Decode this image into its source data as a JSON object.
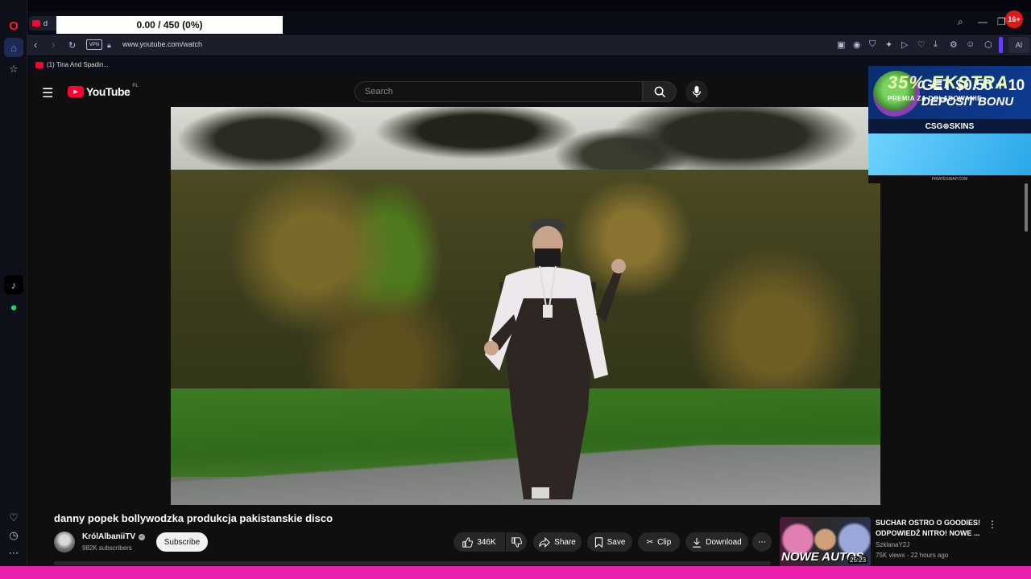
{
  "counter": "0.00 / 450 (0%)",
  "browser": {
    "tab_title": "d",
    "url": "www.youtube.com/watch",
    "vpn": "VPN",
    "notification_count": "16+",
    "ai_label": "AI",
    "bookmark": "(1) Tina And Spadin..."
  },
  "youtube": {
    "logo": "YouTube",
    "region": "PL",
    "search_placeholder": "Search",
    "video_title": "danny popek bollywodzka produkcja pakistanskie disco",
    "channel_name": "KrólAlbaniiTV",
    "subscribers": "982K subscribers",
    "subscribe": "Subscribe",
    "likes": "346K",
    "share": "Share",
    "save": "Save",
    "clip": "Clip",
    "download": "Download"
  },
  "ad": {
    "line1": "GET $0.50 + 10",
    "line2": "DEPOSIT BONU",
    "brand": "CSG⊕SKINS",
    "promo": "35% EKSTRA",
    "promo_sub": "PREMIA ZA DOŁADOWANIE",
    "footer": "PIRATESWAP.COM"
  },
  "recommended": {
    "title": "SUCHAR OSTRO O GOODIES! ODPOWIEDŹ NITRO! NOWE ...",
    "channel": "SzklanaY2J",
    "meta": "75K views · 22 hours ago",
    "duration": "25:23",
    "thumb_text": "NOWE AUTOS"
  },
  "icons": [
    "opera-logo",
    "home-icon",
    "star-icon",
    "tiktok-icon",
    "spotify-icon",
    "heart-icon",
    "clock-icon",
    "more-icon",
    "search-icon",
    "mic-icon",
    "like-icon",
    "dislike-icon",
    "share-icon",
    "save-icon",
    "clip-icon",
    "download-icon"
  ],
  "colors": {
    "accent": "#ff0033",
    "opera_red": "#ff1b2d",
    "pink_bar": "#ec1fb0"
  }
}
